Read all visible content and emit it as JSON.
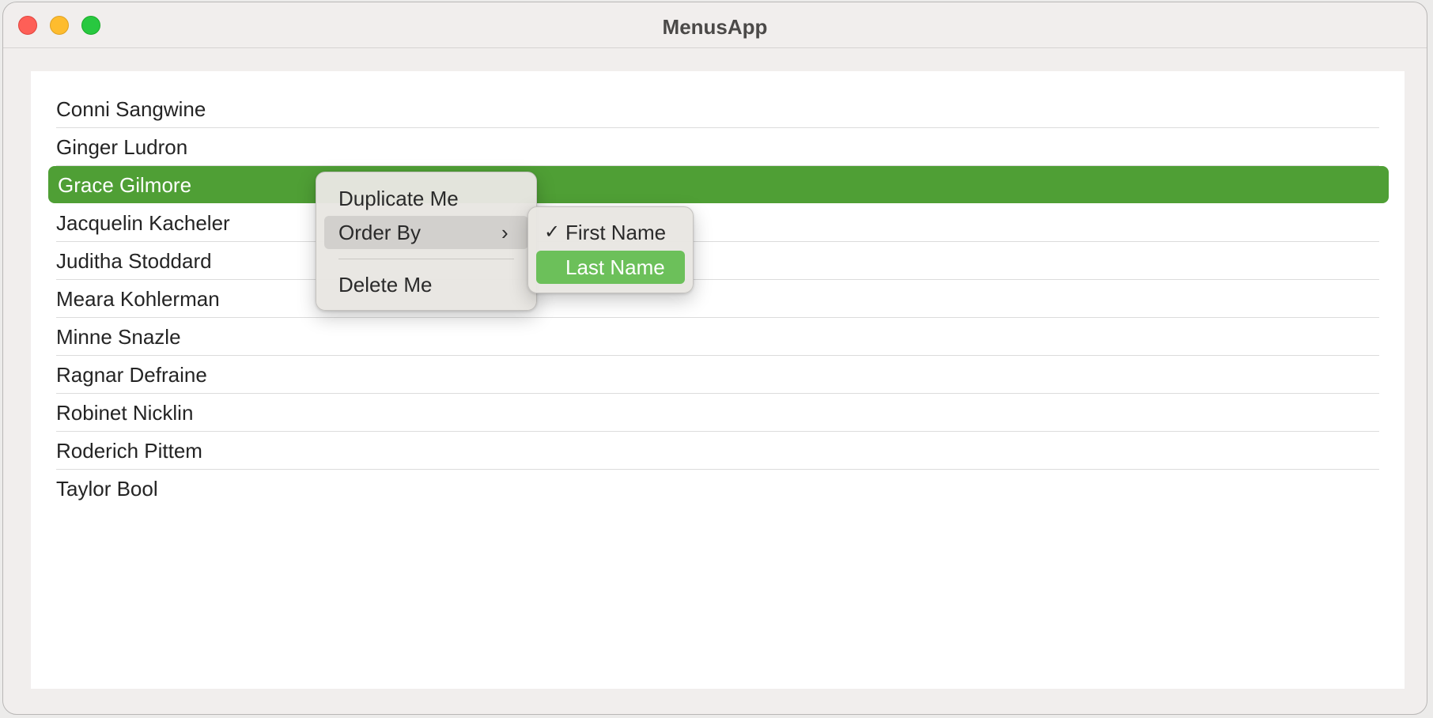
{
  "window": {
    "title": "MenusApp"
  },
  "list": {
    "items": [
      {
        "name": "Conni Sangwine"
      },
      {
        "name": "Ginger Ludron"
      },
      {
        "name": "Grace Gilmore",
        "selected": true
      },
      {
        "name": "Jacquelin Kacheler"
      },
      {
        "name": "Juditha Stoddard"
      },
      {
        "name": "Meara Kohlerman"
      },
      {
        "name": "Minne Snazle"
      },
      {
        "name": "Ragnar Defraine"
      },
      {
        "name": "Robinet Nicklin"
      },
      {
        "name": "Roderich Pittem"
      },
      {
        "name": "Taylor Bool"
      }
    ]
  },
  "context_menu": {
    "duplicate_label": "Duplicate Me",
    "order_by_label": "Order By",
    "order_by_chevron": "›",
    "delete_label": "Delete Me"
  },
  "submenu": {
    "first_name_label": "First Name",
    "first_name_checked": true,
    "checkmark": "✓",
    "last_name_label": "Last Name"
  },
  "colors": {
    "selection": "#4f9f35",
    "menu_highlight": "#6cc05a",
    "close": "#fe5f57",
    "minimize": "#febc2e",
    "zoom": "#28c840"
  }
}
